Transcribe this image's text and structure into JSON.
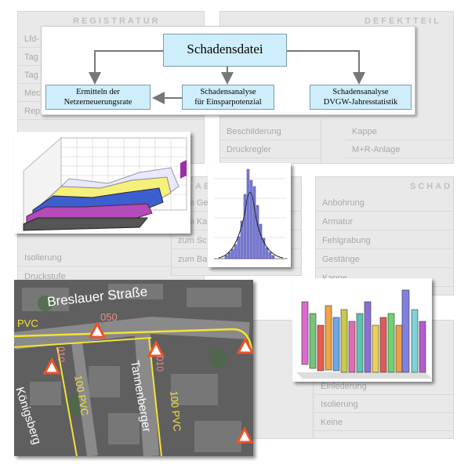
{
  "flow": {
    "main": "Schadensdatei",
    "left_box": [
      "Ermitteln der",
      "Netzerneuerungsrate"
    ],
    "mid_box": [
      "Schadensanalyse",
      "für Einsparpotenzial"
    ],
    "right_box": [
      "Schadensanalyse",
      "DVGW-Jahresstatistik"
    ]
  },
  "form": {
    "registratur_title": "REGISTRATUR",
    "defektteil_title": "DEFEKTTEIL",
    "schad_title": "SCHAD",
    "ab_title": "AB",
    "registratur_rows": [
      "Lfd-",
      "Tag",
      "Tag",
      "Mec",
      "Rep"
    ],
    "defektteil_rows": [
      {
        "left": "Beschilderung",
        "right": "Kappe"
      },
      {
        "left": "Druckregler",
        "right": "M+R-Anlage"
      }
    ],
    "left_lower_rows": [
      "Isolierung",
      "Druckstufe"
    ],
    "ab_rows": [
      "zum Ge",
      "zum Ka",
      "zum Sc",
      "zum Ba"
    ],
    "schad_rows": [
      "Anbohrung",
      "Armatur",
      "Fehlgrabung",
      "Gestänge",
      "Kappe"
    ],
    "bottom_rows": [
      "Isolierung",
      "Keine"
    ],
    "bottom_row_partial": "Einlederung"
  },
  "map": {
    "street1": "Breslauer Straße",
    "street2": "Tannenberger",
    "street3": "Königsberg",
    "pipe_labels": [
      "PVC",
      "050",
      "010",
      "100 PVC",
      "010",
      "100 PVC"
    ]
  },
  "colors": {
    "flow_box": "#cfeefb",
    "map_label": "#f2e23a",
    "warning": "#e8542b"
  },
  "icons": [
    "warning-triangle-icon"
  ]
}
